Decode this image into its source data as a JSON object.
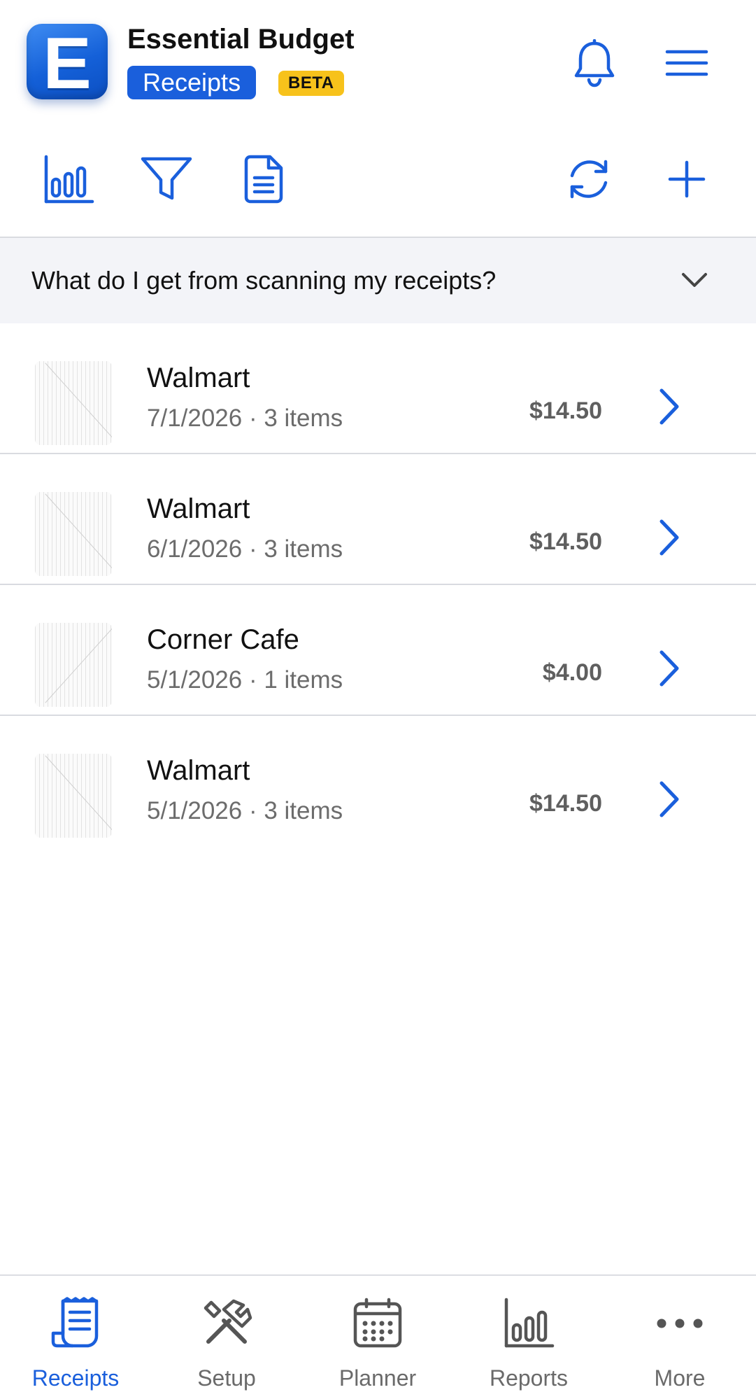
{
  "header": {
    "logo_letter": "E",
    "app_title": "Essential Budget",
    "section_label": "Receipts",
    "beta_label": "BETA"
  },
  "icons": {
    "bell": "bell-icon",
    "menu": "hamburger-menu-icon",
    "chart": "bar-chart-icon",
    "filter": "filter-icon",
    "document": "document-icon",
    "sync": "sync-icon",
    "add": "plus-icon",
    "chevron_down": "chevron-down-icon",
    "chevron_right": "chevron-right-icon"
  },
  "colors": {
    "accent": "#1a5fdc",
    "beta": "#f7c21b",
    "faq_background": "#f3f4f8",
    "muted_text": "#6c6c6c"
  },
  "faq": {
    "question": "What do I get from scanning my receipts?"
  },
  "receipts": [
    {
      "merchant": "Walmart",
      "meta": "7/1/2026 · 3 items",
      "amount": "$14.50"
    },
    {
      "merchant": "Walmart",
      "meta": "6/1/2026 · 3 items",
      "amount": "$14.50"
    },
    {
      "merchant": "Corner Cafe",
      "meta": "5/1/2026 · 1 items",
      "amount": "$4.00"
    },
    {
      "merchant": "Walmart",
      "meta": "5/1/2026 · 3 items",
      "amount": "$14.50"
    }
  ],
  "nav": [
    {
      "label": "Receipts",
      "icon": "receipt-icon",
      "active": true
    },
    {
      "label": "Setup",
      "icon": "tools-icon",
      "active": false
    },
    {
      "label": "Planner",
      "icon": "calendar-icon",
      "active": false
    },
    {
      "label": "Reports",
      "icon": "bar-chart-icon",
      "active": false
    },
    {
      "label": "More",
      "icon": "more-dots-icon",
      "active": false
    }
  ]
}
